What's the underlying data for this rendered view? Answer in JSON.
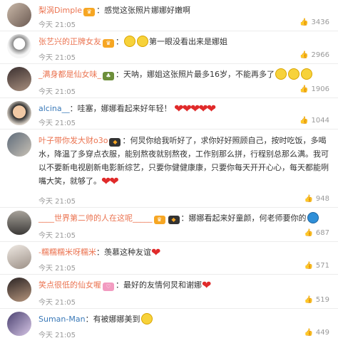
{
  "comments": [
    {
      "user": "梨涡Dimple",
      "text": "感觉这张照片娜娜好嫩啊",
      "time": "今天 21:05",
      "likes": "3436"
    },
    {
      "user": "张艺兴的正牌女友",
      "text": "第一眼没看出来是娜姐",
      "time": "今天 21:05",
      "likes": "2966"
    },
    {
      "user": "_满身都是仙女味_",
      "text": "天呐，娜姐这张照片最多16岁，不能再多了",
      "time": "今天 21:05",
      "likes": "1906"
    },
    {
      "user": "alcina__",
      "text": "哇塞，娜娜看起来好年轻！",
      "time": "今天 21:05",
      "likes": "1044"
    },
    {
      "user": "叶子带你发大财o3o",
      "text": "何炅你给我听好了，求你好好照顾自己，按时吃饭，多喝水，降温了多穿点衣服，能别熬夜就别熬夜，工作别那么拼，行程别总那么满。我可以不要新电视剧新电影新综艺，只要你健健康康，只要你每天开开心心，每天都能咧嘴大笑，就够了。",
      "time": "今天 21:05",
      "likes": "948"
    },
    {
      "user": "____世界第二帅的人在这呢_____",
      "text": "娜娜看起来好童颜，何老师要你的",
      "time": "今天 21:05",
      "likes": "687"
    },
    {
      "user": "-糯糯糯米呀糯米",
      "text": "羡慕这种友谊",
      "time": "今天 21:05",
      "likes": "571"
    },
    {
      "user": "笑点很低的仙女喔",
      "text": "最好的友情何炅和谢娜",
      "time": "今天 21:05",
      "likes": "519"
    },
    {
      "user": "Suman-Man",
      "text": "有被娜娜美到",
      "time": "今天 21:05",
      "likes": "449"
    }
  ]
}
